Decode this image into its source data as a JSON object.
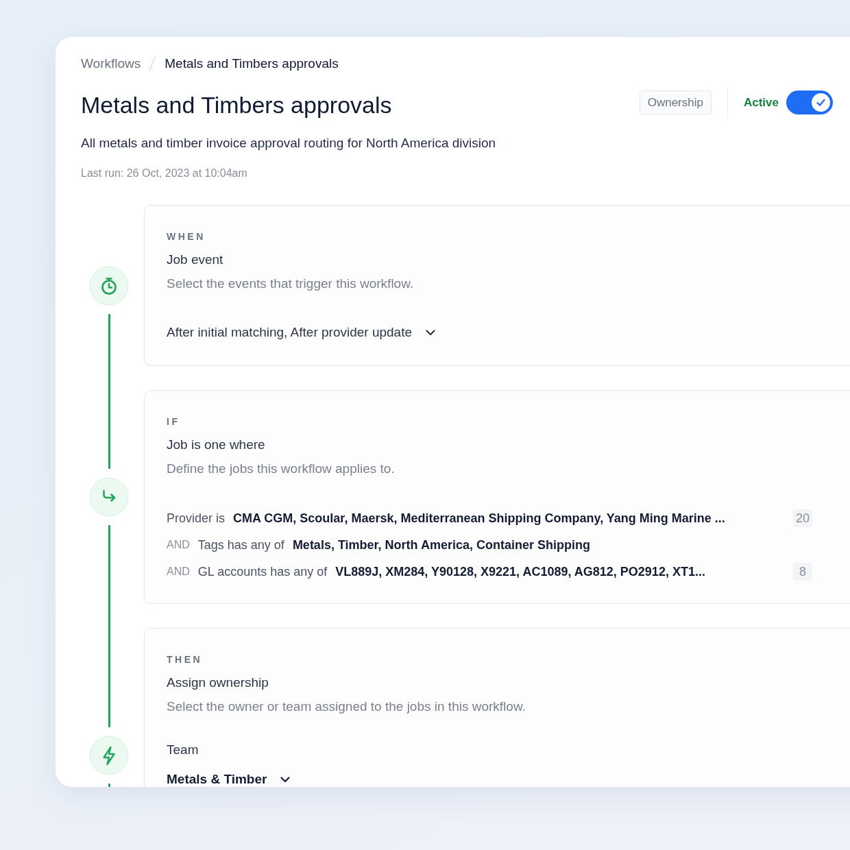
{
  "breadcrumb": [
    {
      "label": "Workflows",
      "current": false
    },
    {
      "label": "Metals and Timbers approvals",
      "current": true
    }
  ],
  "header": {
    "title": "Metals and Timbers approvals",
    "ownership_button": "Ownership",
    "status": {
      "label": "Active",
      "on": true
    },
    "description": "All metals and timber invoice approval routing for North America division",
    "last_run": "Last run: 26 Oct, 2023 at 10:04am"
  },
  "steps": [
    {
      "kind": "trigger",
      "label": "WHEN",
      "title": "Job event",
      "hint": "Select the events that trigger this workflow.",
      "value": "After initial matching, After provider update"
    },
    {
      "kind": "condition",
      "label": "IF",
      "title": "Job is one where",
      "hint": "Define the jobs this workflow applies to.",
      "rules": [
        {
          "field": "Provider is",
          "values": "CMA CGM, Scoular, Maersk, Mediterranean Shipping Company, Yang Ming Marine ...",
          "count": "20"
        },
        {
          "connector": "AND",
          "field": "Tags has any of",
          "values": "Metals, Timber, North America, Container Shipping"
        },
        {
          "connector": "AND",
          "field": "GL accounts has any of",
          "values": "VL889J, XM284, Y90128, X9221, AC1089, AG812, PO2912, XT1...",
          "count": "8"
        }
      ]
    },
    {
      "kind": "action",
      "label": "THEN",
      "title": "Assign ownership",
      "hint": "Select the owner or team assigned to the jobs in this workflow.",
      "field_label": "Team",
      "value": "Metals & Timber"
    }
  ]
}
